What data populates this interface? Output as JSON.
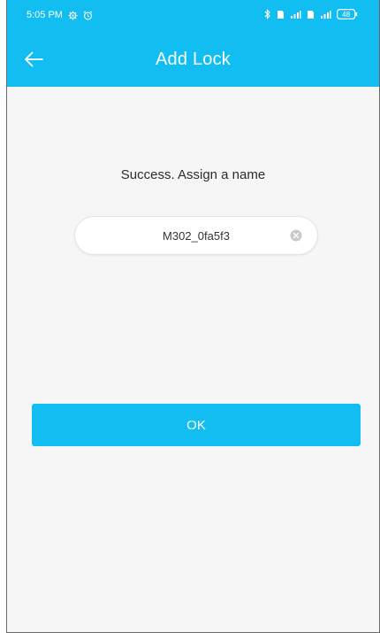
{
  "status_bar": {
    "time": "5:05 PM",
    "battery": "48"
  },
  "app_bar": {
    "title": "Add Lock",
    "back_icon": "arrow-left-icon"
  },
  "prompt": {
    "text": "Success. Assign a name"
  },
  "name_field": {
    "value": "M302_0fa5f3",
    "clear_icon": "clear-circle-icon"
  },
  "ok_button": {
    "label": "OK"
  },
  "colors": {
    "accent": "#12bdf2",
    "background": "#f6f6f6",
    "text": "#2c2c2c"
  }
}
